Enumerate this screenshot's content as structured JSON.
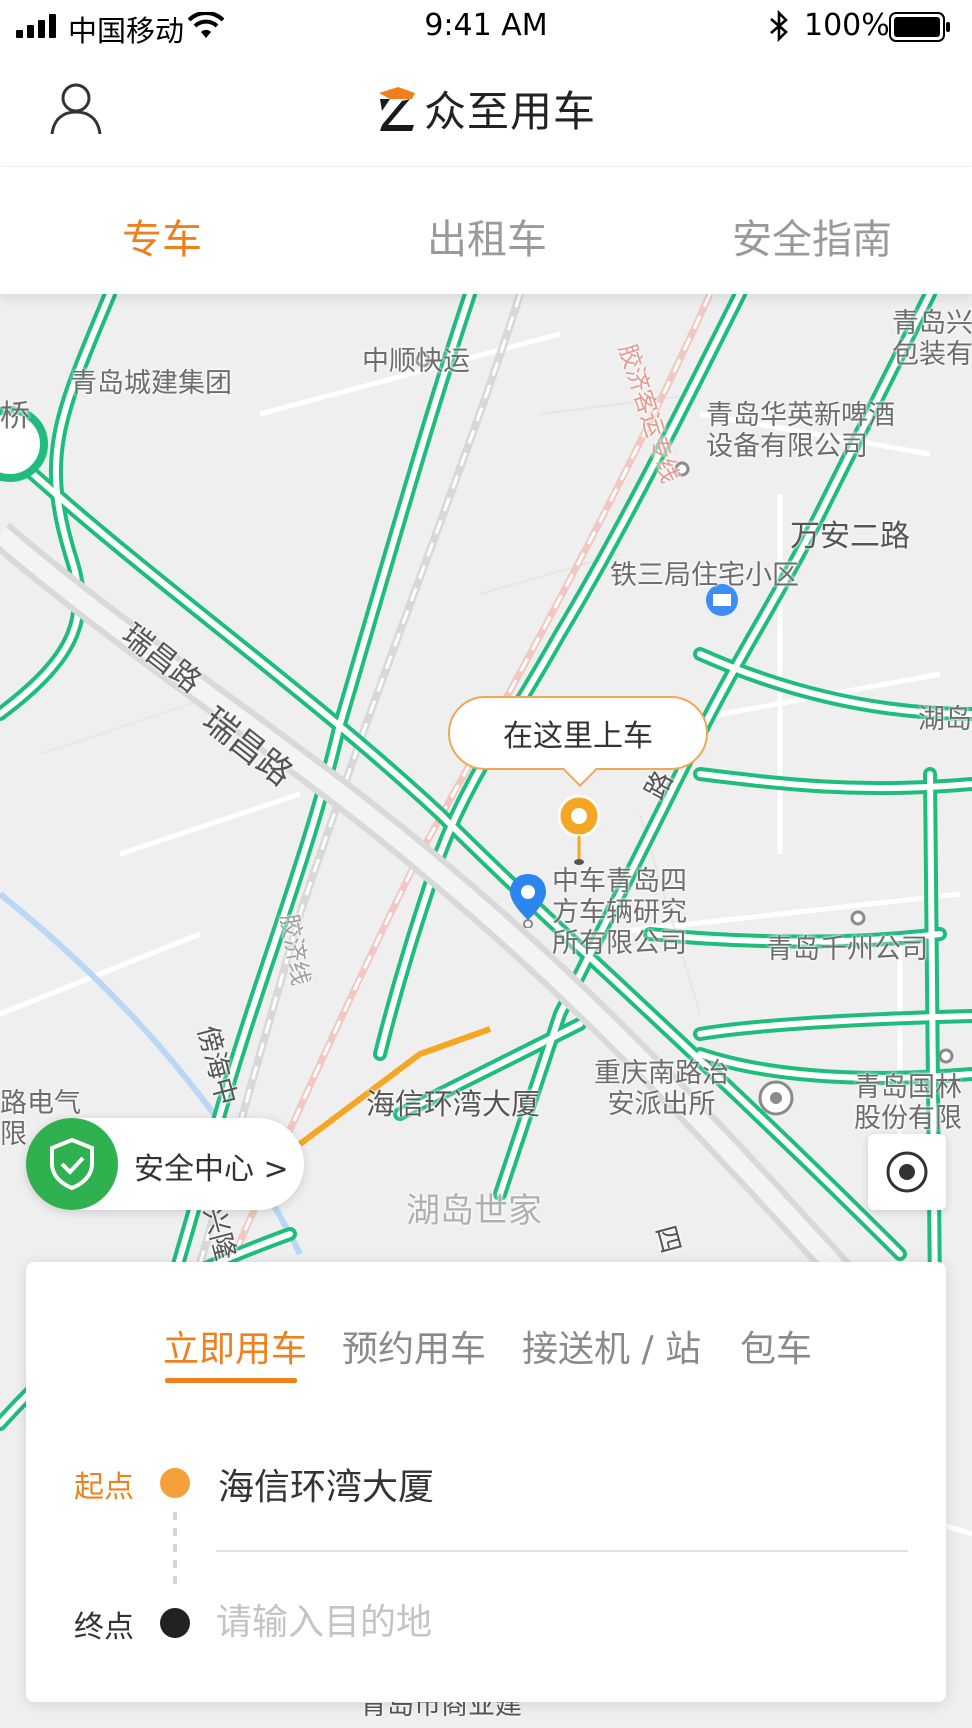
{
  "status_bar": {
    "carrier": "中国移动",
    "time": "9:41 AM",
    "battery": "100%"
  },
  "header": {
    "brand_name": "众至用车",
    "icons": {
      "user": "user-icon",
      "logo": "brand-logo"
    }
  },
  "top_tabs": [
    {
      "label": "专车",
      "active": true
    },
    {
      "label": "出租车",
      "active": false
    },
    {
      "label": "安全指南",
      "active": false
    }
  ],
  "map": {
    "pickup_bubble": "在这里上车",
    "safety_center": {
      "label": "安全中心",
      "chevron": ">"
    },
    "labels": {
      "qingdao_city_construction": "青岛城建集团",
      "zhongshun_express": "中顺快运",
      "jiaoji_freight_line": "胶济客运专线",
      "huaying_beer": "青岛华英新啤酒\n设备有限公司",
      "qingdao_xing_packaging": "青岛兴\n包装有",
      "tie3ju_residence": "铁三局住宅小区",
      "wanan_2nd_road": "万安二路",
      "ruichang_road_1": "瑞昌路",
      "ruichang_road_2": "瑞昌路",
      "sifang_vehicle": "中车青岛四\n方车辆研究\n所有限公司",
      "qianzhou": "青岛千州公司",
      "hudao_right": "湖岛",
      "chongqing_police": "重庆南路治\n安派出所",
      "guolin": "青岛国林\n股份有限",
      "haixin_building": "海信环湾大厦",
      "hudao_shijia": "湖岛世家",
      "road_electric": "路电气\n限",
      "bridge": "桥",
      "jiaoji_line": "胶济线",
      "bang_hai": "傍海中",
      "xing_road": "兴隆",
      "si_road": "四",
      "lu": "路",
      "commercial": "青岛市商业建"
    },
    "route_color": "#1fbd7c",
    "accent_color": "#f0801e"
  },
  "booking": {
    "tabs": [
      {
        "label": "立即用车",
        "active": true
      },
      {
        "label": "预约用车",
        "active": false
      },
      {
        "label": "接送机 / 站",
        "active": false
      },
      {
        "label": "包车",
        "active": false
      }
    ],
    "start_label": "起点",
    "start_value": "海信环湾大厦",
    "end_label": "终点",
    "end_placeholder": "请输入目的地",
    "end_value": ""
  }
}
